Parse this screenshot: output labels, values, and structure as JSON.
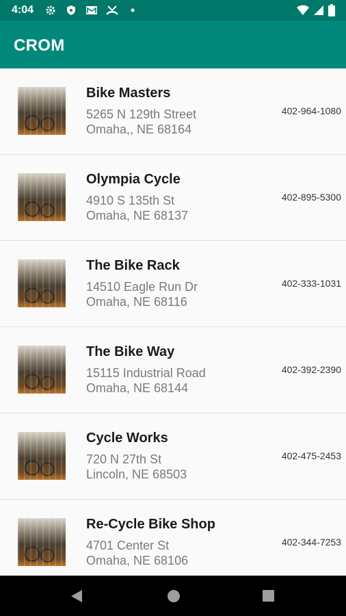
{
  "status_bar": {
    "time": "4:04",
    "icons_left": [
      "settings-icon",
      "shield-icon",
      "mail-icon",
      "missed-call-icon",
      "dot-icon"
    ],
    "icons_right": [
      "wifi-icon",
      "signal-icon",
      "battery-icon"
    ]
  },
  "app_bar": {
    "title": "CROM"
  },
  "shops": [
    {
      "name": "Bike Masters",
      "address_line1": "5265 N 129th Street",
      "address_line2": "Omaha,, NE 68164",
      "phone": "402-964-1080"
    },
    {
      "name": "Olympia Cycle",
      "address_line1": "4910 S 135th St",
      "address_line2": "Omaha, NE 68137",
      "phone": "402-895-5300"
    },
    {
      "name": "The Bike Rack",
      "address_line1": "14510 Eagle Run Dr",
      "address_line2": "Omaha, NE 68116",
      "phone": "402-333-1031"
    },
    {
      "name": "The Bike Way",
      "address_line1": "15115 Industrial Road",
      "address_line2": "Omaha, NE 68144",
      "phone": "402-392-2390"
    },
    {
      "name": "Cycle Works",
      "address_line1": "720 N 27th St",
      "address_line2": "Lincoln, NE 68503",
      "phone": "402-475-2453"
    },
    {
      "name": "Re-Cycle Bike Shop",
      "address_line1": "4701 Center St",
      "address_line2": "Omaha, NE 68106",
      "phone": "402-344-7253"
    }
  ],
  "nav_bar": {
    "icons": [
      "back-icon",
      "home-icon",
      "recents-icon"
    ]
  },
  "colors": {
    "status_bar": "#00796b",
    "app_bar": "#00897b",
    "background": "#fafafa"
  }
}
